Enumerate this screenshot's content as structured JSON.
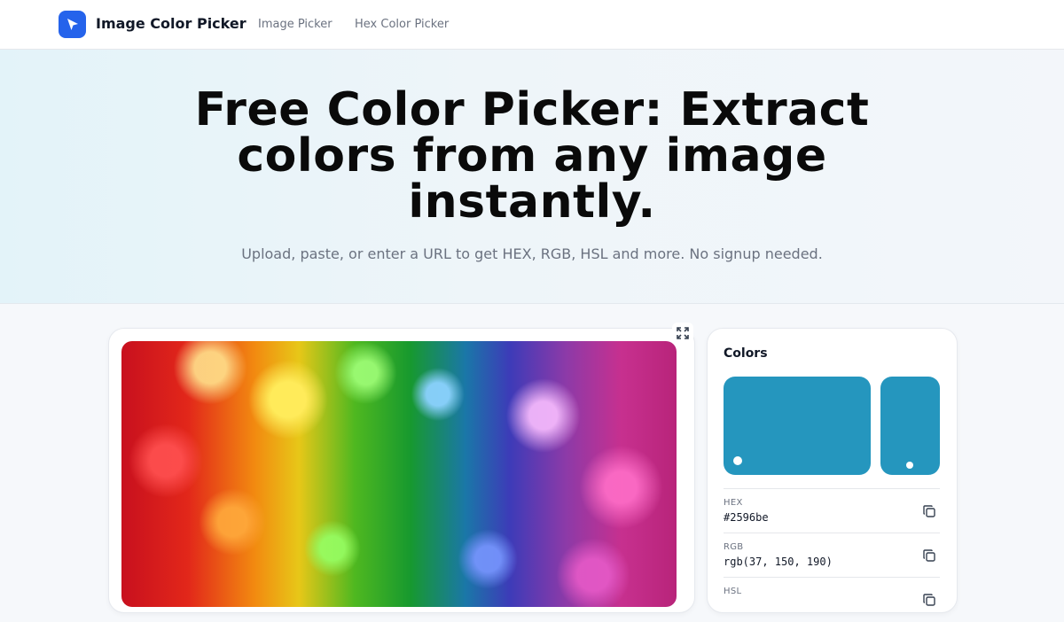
{
  "nav": {
    "brand": "Image Color Picker",
    "links": [
      "Image Picker",
      "Hex Color Picker"
    ],
    "logo_icon": "cursor-arrow-icon"
  },
  "hero": {
    "title": "Free Color Picker: Extract colors from any image instantly.",
    "subtitle": "Upload, paste, or enter a URL to get HEX, RGB, HSL and more. No signup needed."
  },
  "image_card": {
    "expand_icon": "expand-icon"
  },
  "colors": {
    "title": "Colors",
    "selected_color": "#2596be",
    "values": [
      {
        "label": "HEX",
        "value": "#2596be"
      },
      {
        "label": "RGB",
        "value": "rgb(37, 150, 190)"
      },
      {
        "label": "HSL",
        "value": ""
      }
    ],
    "copy_icon": "copy-icon"
  },
  "colors_theme": {
    "accent": "#2563eb",
    "swatch": "#2596be"
  }
}
